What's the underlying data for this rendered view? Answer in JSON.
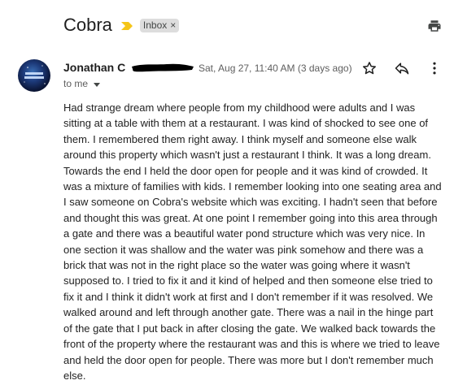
{
  "email": {
    "subject": "Cobra",
    "label": "Inbox",
    "label_remove": "×",
    "sender_name": "Jonathan C",
    "date": "Sat, Aug 27, 11:40 AM (3 days ago)",
    "recipient": "to me",
    "body": "Had strange dream where people from my childhood were adults and I was sitting at a table with them at a restaurant. I was kind of shocked to see one of them. I remembered them right away. I think myself and someone else walk around this property which wasn't just a restaurant I think. It was a long dream. Towards the end I held the door open for people and it was kind of crowded. It was a mixture of families with kids. I remember looking into one seating area and I saw someone on Cobra's website which was exciting. I hadn't seen that before and thought this was great. At one point I remember going into this area through a gate and there was a beautiful water pond structure which was very nice. In one section it was shallow and the water was pink somehow and there was a brick that was not in the right place so the water was going where it wasn't supposed to. I tried to fix it and it kind of helped and then someone else tried to fix it and I think it didn't work at first and I don't remember if it was resolved. We walked around and left through another gate. There was a nail in the hinge part of the gate that I put back in after closing the gate. We walked back towards the front of the property where the restaurant was and this is where we tried to leave and held the door open for people. There was more but I don't remember much else."
  },
  "icons": {
    "importance": "importance-marker-icon",
    "print": "print-icon",
    "star": "star-icon",
    "reply": "reply-icon",
    "more": "more-vert-icon",
    "caret": "caret-down-icon"
  },
  "colors": {
    "importance": "#f5c518",
    "chip_bg": "#dddddd",
    "text": "#222222",
    "muted": "#5e5e5e"
  }
}
